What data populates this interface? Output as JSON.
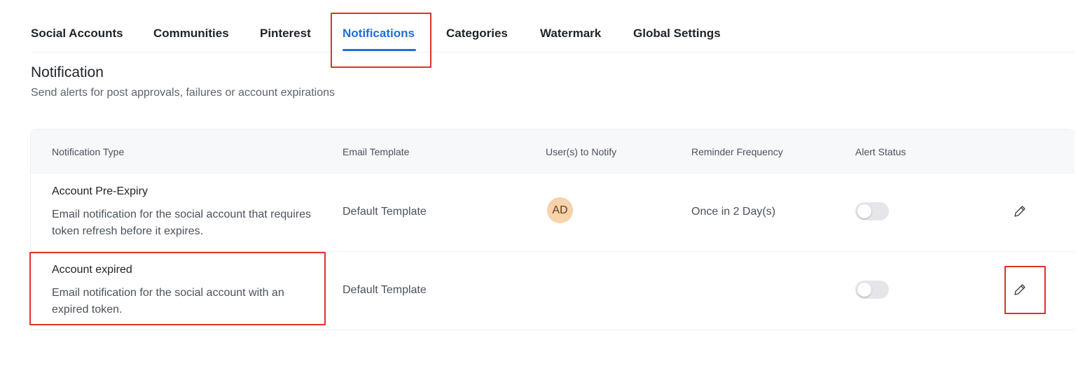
{
  "tabs": [
    {
      "label": "Social Accounts"
    },
    {
      "label": "Communities"
    },
    {
      "label": "Pinterest"
    },
    {
      "label": "Notifications",
      "active": true
    },
    {
      "label": "Categories"
    },
    {
      "label": "Watermark"
    },
    {
      "label": "Global Settings"
    }
  ],
  "section": {
    "title": "Notification",
    "subtitle": "Send alerts for post approvals, failures or account expirations"
  },
  "table": {
    "columns": [
      "Notification Type",
      "Email Template",
      "User(s) to Notify",
      "Reminder Frequency",
      "Alert Status"
    ],
    "rows": [
      {
        "type_title": "Account Pre-Expiry",
        "type_desc": "Email notification for the social account that requires token refresh before it expires.",
        "email_template": "Default Template",
        "users": "AD",
        "frequency": "Once in 2 Day(s)",
        "alert_enabled": false,
        "edit_icon": "pencil-icon"
      },
      {
        "type_title": "Account expired",
        "type_desc": "Email notification for the social account with an expired token.",
        "email_template": "Default Template",
        "users": "",
        "frequency": "",
        "alert_enabled": false,
        "edit_icon": "pencil-icon"
      }
    ]
  },
  "colors": {
    "accent": "#1f6fd6",
    "highlight": "#e0322a",
    "avatar_bg": "#f8d2aa"
  }
}
